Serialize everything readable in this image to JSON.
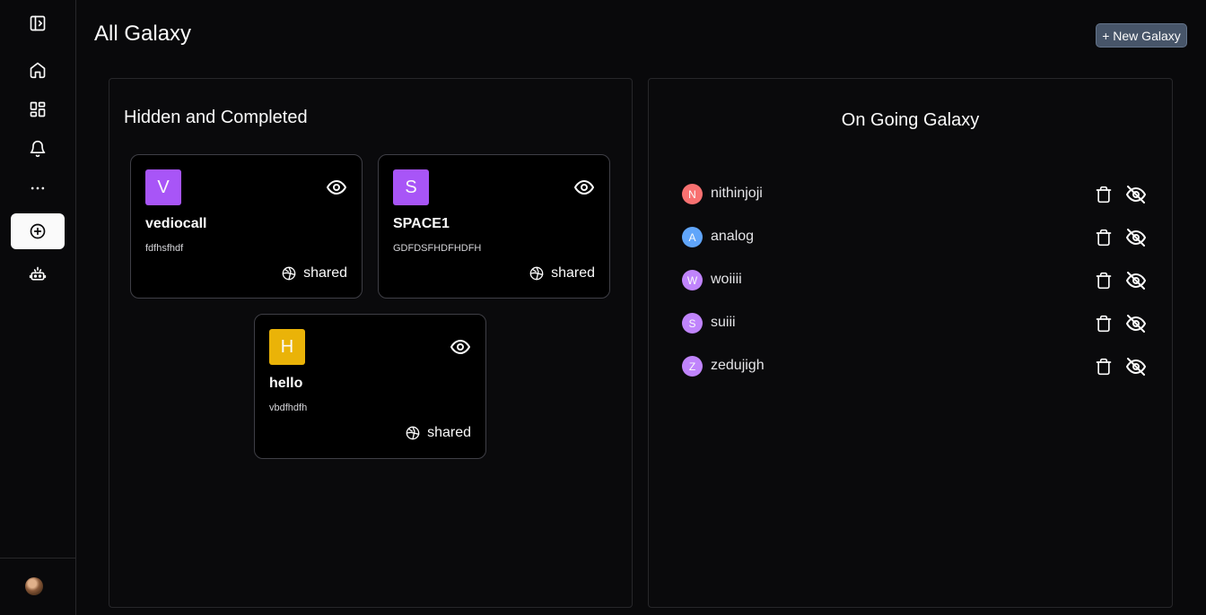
{
  "header": {
    "title": "All Galaxy",
    "new_button_label": "+ New Galaxy"
  },
  "sidebar": {
    "items": [
      {
        "icon": "panel-toggle-icon"
      },
      {
        "icon": "home-icon"
      },
      {
        "icon": "dashboard-icon"
      },
      {
        "icon": "bell-icon"
      },
      {
        "icon": "more-icon"
      },
      {
        "icon": "plus-circle-icon",
        "active": true
      },
      {
        "icon": "bot-icon"
      }
    ],
    "user_avatar": "user-avatar"
  },
  "hidden_completed": {
    "heading": "Hidden and Completed",
    "cards": [
      {
        "letter": "V",
        "name": "vediocall",
        "description": "fdfhsfhdf",
        "shared_label": "shared",
        "color": "#a855f7"
      },
      {
        "letter": "S",
        "name": "SPACE1",
        "description": "GDFDSFHDFHDFH",
        "shared_label": "shared",
        "color": "#a855f7"
      },
      {
        "letter": "H",
        "name": "hello",
        "description": "vbdfhdfh",
        "shared_label": "shared",
        "color": "#eab308"
      }
    ]
  },
  "ongoing": {
    "heading": "On Going Galaxy",
    "items": [
      {
        "letter": "N",
        "name": "nithinjoji",
        "color": "#f87171"
      },
      {
        "letter": "A",
        "name": "analog",
        "color": "#60a5fa"
      },
      {
        "letter": "W",
        "name": "woiiii",
        "color": "#c084fc"
      },
      {
        "letter": "S",
        "name": "suiii",
        "color": "#c084fc"
      },
      {
        "letter": "Z",
        "name": "zedujigh",
        "color": "#c084fc"
      }
    ]
  }
}
